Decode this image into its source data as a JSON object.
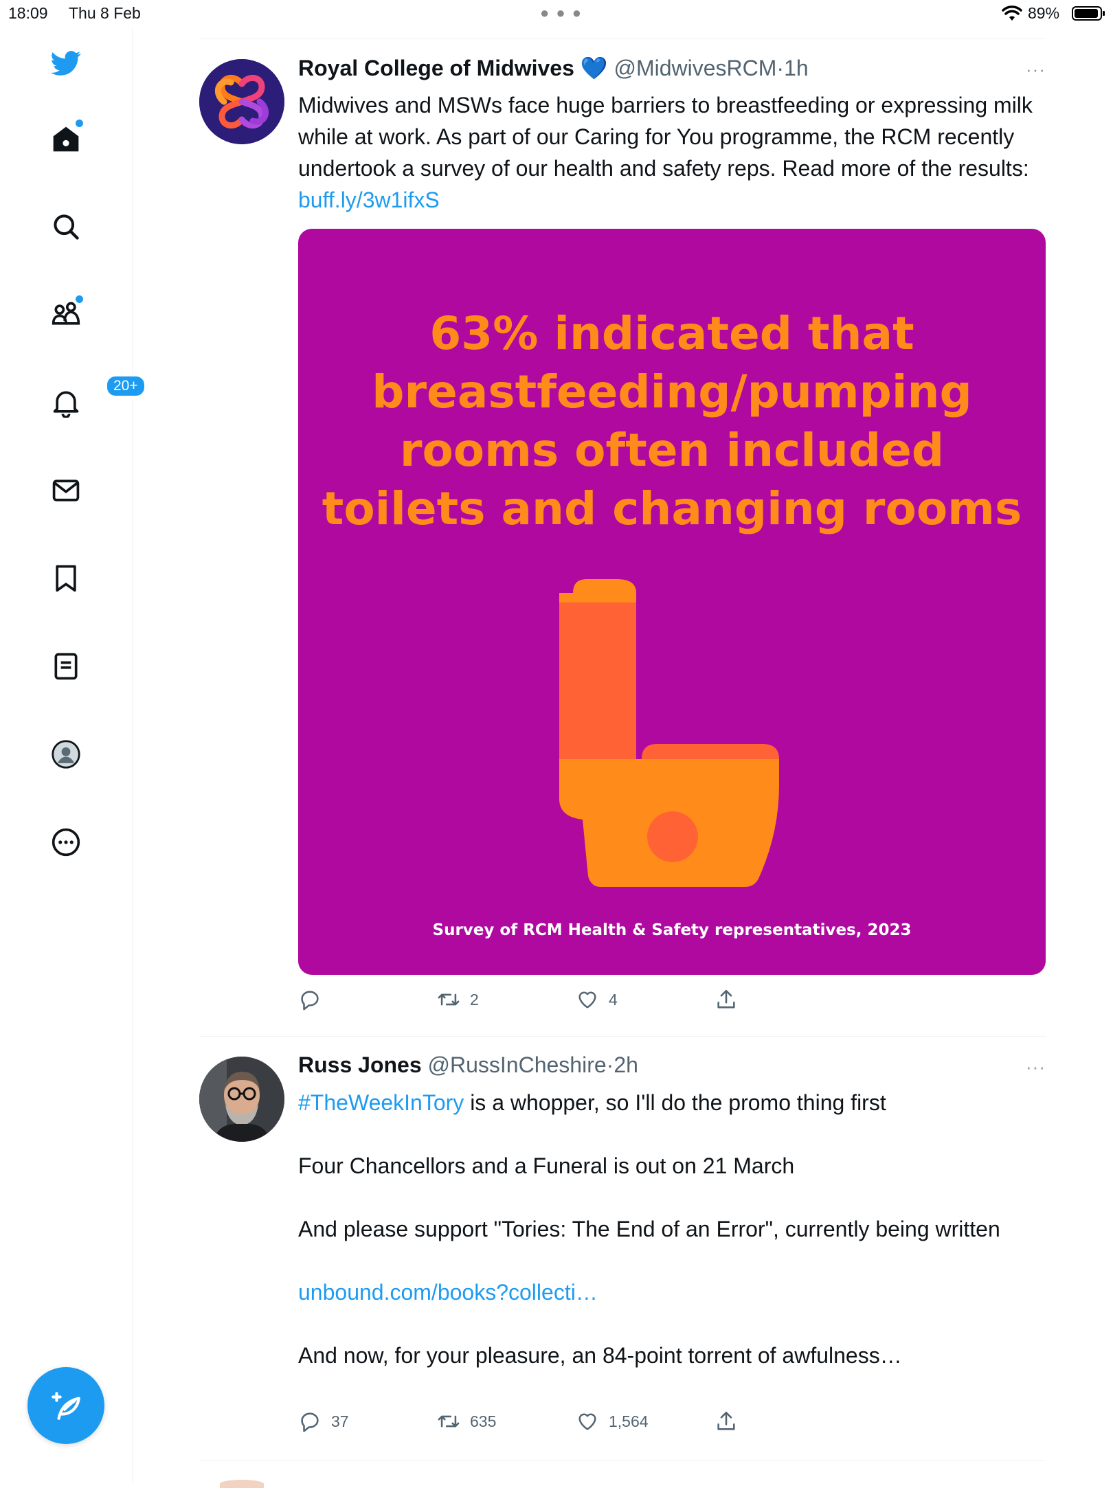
{
  "status": {
    "time": "18:09",
    "date": "Thu 8 Feb",
    "battery": "89%"
  },
  "sidebar": {
    "notifications_badge": "20+",
    "items": [
      {
        "icon": "home-icon",
        "has_dot": true
      },
      {
        "icon": "search-icon",
        "has_dot": false
      },
      {
        "icon": "communities-icon",
        "has_dot": true
      },
      {
        "icon": "bell-icon",
        "has_dot": false
      },
      {
        "icon": "mail-icon",
        "has_dot": false
      },
      {
        "icon": "bookmark-icon",
        "has_dot": false
      },
      {
        "icon": "list-icon",
        "has_dot": false
      },
      {
        "icon": "profile-icon",
        "has_dot": false
      },
      {
        "icon": "more-circle-icon",
        "has_dot": false
      }
    ],
    "compose_icon": "compose-feather-icon"
  },
  "tweets": [
    {
      "name": "Royal College of Midwives",
      "verified_emoji": "💙",
      "handle": "@MidwivesRCM",
      "sep": "·",
      "time": "1h",
      "more": "···",
      "text": "Midwives and MSWs face huge barriers to breastfeeding or expressing milk while at work. As part of our Caring for You programme, the RCM recently undertook a survey of our health and safety reps. Read more of the results: ",
      "link": "buff.ly/3w1ifxS",
      "media": {
        "headline_lines": [
          "63% indicated that",
          "breastfeeding/pumping",
          "rooms often included",
          "toilets and changing rooms"
        ],
        "caption": "Survey of RCM Health & Safety representatives, 2023",
        "bg_color": "#b0099f",
        "text_color": "#ff8c1a"
      },
      "actions": {
        "reply": "",
        "retweet": "2",
        "like": "4"
      }
    },
    {
      "name": "Russ Jones",
      "handle": "@RussInCheshire",
      "sep": "·",
      "time": "2h",
      "more": "···",
      "hashtag": "#TheWeekInTory",
      "line1_rest": " is a whopper, so I'll do the promo thing first",
      "line2": "Four Chancellors and a Funeral is out on 21 March",
      "line3": "And please support \"Tories: The End of an Error\", currently being written",
      "link": "unbound.com/books?collecti…",
      "line4": "And now, for your pleasure, an 84-point torrent of awfulness…",
      "actions": {
        "reply": "37",
        "retweet": "635",
        "like": "1,564"
      }
    }
  ],
  "colors": {
    "accent": "#1d9bf0",
    "text": "#0f1419",
    "muted": "#536471"
  }
}
